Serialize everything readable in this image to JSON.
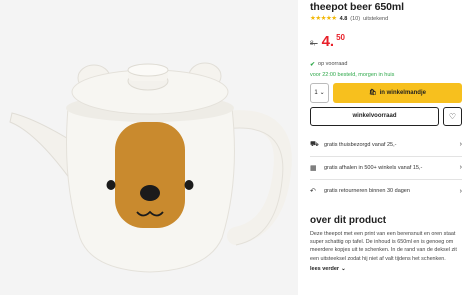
{
  "product": {
    "title": "theepot beer 650ml",
    "rating": {
      "stars": "★★★★★",
      "score": "4.8",
      "reviews": "(10)",
      "reviews_label": "uitstekend"
    },
    "price": {
      "old": "8,-",
      "main": "4.",
      "cents": "50"
    },
    "stock": {
      "check_icon": "✔",
      "label": "op voorraad"
    },
    "delivery": "voor 22:00 besteld, morgen in huis"
  },
  "buy": {
    "quantity": "1",
    "quantity_chevron": "⌄",
    "cart_icon": "🛍",
    "add_label": "in winkelmandje",
    "store_label": "winkelvoorraad",
    "fav_icon": "♡"
  },
  "perks": [
    {
      "icon": "⛟",
      "icon_name": "truck-icon",
      "label": "gratis thuisbezorgd vanaf 25,-",
      "arrow": "›"
    },
    {
      "icon": "▦",
      "icon_name": "store-icon",
      "label": "gratis afhalen in 500+ winkels vanaf 15,-",
      "arrow": "›"
    },
    {
      "icon": "↶",
      "icon_name": "return-icon",
      "label": "gratis retourneren binnen 30 dagen",
      "arrow": "›"
    }
  ],
  "about": {
    "title": "over dit product",
    "description": "Deze theepot met een print van een berensnuit en oren staat super schattig op tafel. De inhoud is 650ml en is genoeg om meerdere kopjes uit te schenken. In de rand van de deksel zit een uitsteeksel zodat hij niet af valt tijdens het schenken.",
    "read_more": "lees verder",
    "read_more_icon": "⌄"
  },
  "colors": {
    "accent_yellow": "#f7c01e",
    "price_red": "#e8202a",
    "stock_green": "#2ea84a",
    "bear_brown": "#c98a2e"
  }
}
